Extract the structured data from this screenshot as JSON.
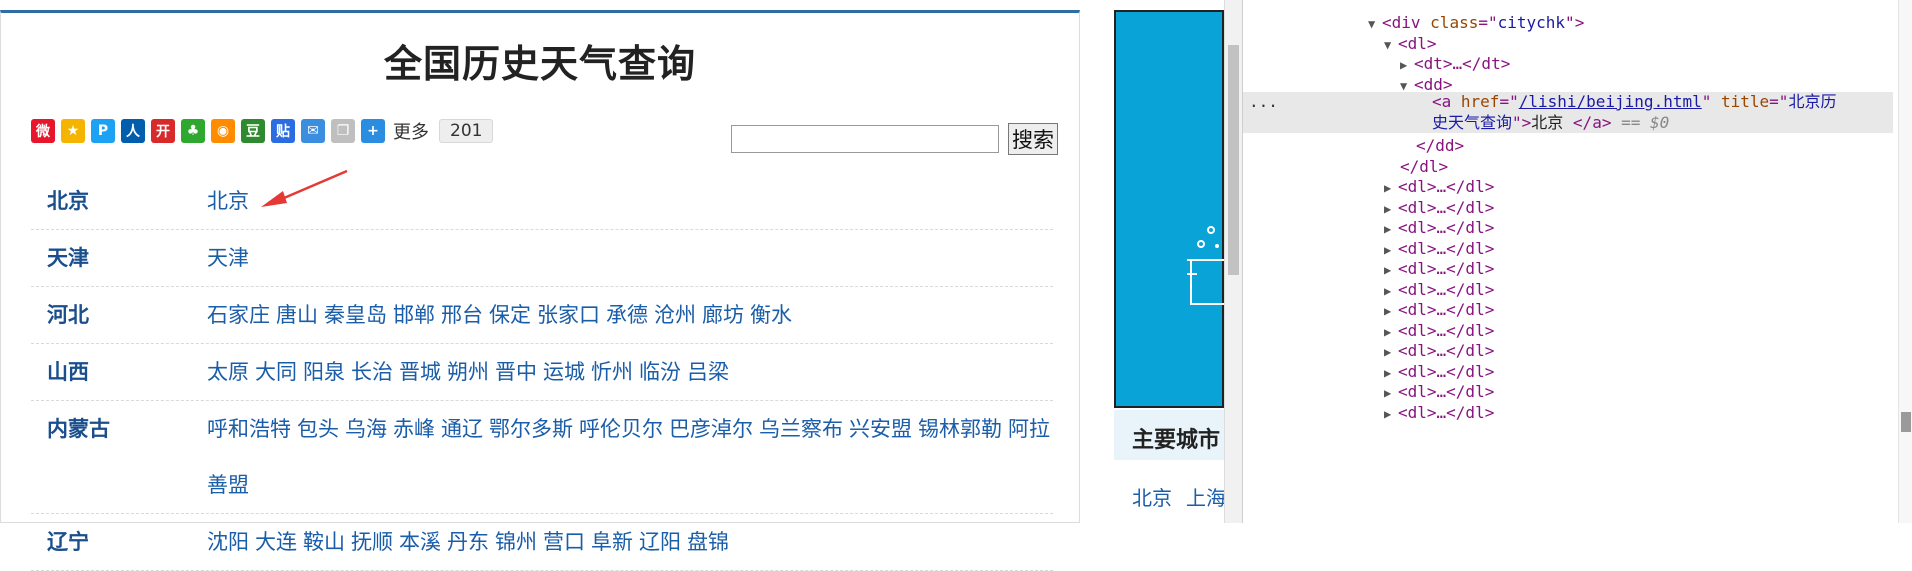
{
  "weather_page": {
    "title": "全国历史天气查询",
    "share": {
      "more_label": "更多",
      "count": "201",
      "icons": [
        {
          "name": "weibo-icon",
          "color": "#e6162d",
          "glyph": "微"
        },
        {
          "name": "qzone-icon",
          "color": "#f5b400",
          "glyph": "★"
        },
        {
          "name": "tencent-weibo-icon",
          "color": "#1da1f2",
          "glyph": "P"
        },
        {
          "name": "renren-icon",
          "color": "#005eac",
          "glyph": "人"
        },
        {
          "name": "kaixin-icon",
          "color": "#d82a2a",
          "glyph": "开"
        },
        {
          "name": "clover-icon",
          "color": "#2ea82e",
          "glyph": "♣"
        },
        {
          "name": "music-icon",
          "color": "#ff8c00",
          "glyph": "◉"
        },
        {
          "name": "douban-icon",
          "color": "#2f8a2f",
          "glyph": "豆"
        },
        {
          "name": "tieba-icon",
          "color": "#2b6de0",
          "glyph": "贴"
        },
        {
          "name": "mail-icon",
          "color": "#3b8ddf",
          "glyph": "✉"
        },
        {
          "name": "copy-icon",
          "color": "#bfbfbf",
          "glyph": "❐"
        },
        {
          "name": "plus-icon",
          "color": "#2b8de0",
          "glyph": "+"
        }
      ]
    },
    "search": {
      "placeholder": "",
      "button": "搜索"
    },
    "provinces": [
      {
        "name": "北京",
        "cities": [
          "北京"
        ]
      },
      {
        "name": "天津",
        "cities": [
          "天津"
        ]
      },
      {
        "name": "河北",
        "cities": [
          "石家庄",
          "唐山",
          "秦皇岛",
          "邯郸",
          "邢台",
          "保定",
          "张家口",
          "承德",
          "沧州",
          "廊坊",
          "衡水"
        ]
      },
      {
        "name": "山西",
        "cities": [
          "太原",
          "大同",
          "阳泉",
          "长治",
          "晋城",
          "朔州",
          "晋中",
          "运城",
          "忻州",
          "临汾",
          "吕梁"
        ]
      },
      {
        "name": "内蒙古",
        "cities": [
          "呼和浩特",
          "包头",
          "乌海",
          "赤峰",
          "通辽",
          "鄂尔多斯",
          "呼伦贝尔",
          "巴彦淖尔",
          "乌兰察布",
          "兴安盟",
          "锡林郭勒",
          "阿拉善盟"
        ]
      },
      {
        "name": "辽宁",
        "cities": [
          "沈阳",
          "大连",
          "鞍山",
          "抚顺",
          "本溪",
          "丹东",
          "锦州",
          "营口",
          "阜新",
          "辽阳",
          "盘锦"
        ]
      }
    ]
  },
  "sidebar": {
    "major_title": "主要城市",
    "major_cities": [
      "北京",
      "上海"
    ]
  },
  "devtools": {
    "lines": [
      {
        "indent": 0,
        "type": "open",
        "tri": "▼",
        "tag": "div",
        "attr": "class",
        "val": "citychk"
      },
      {
        "indent": 1,
        "type": "open",
        "tri": "▼",
        "tag": "dl"
      },
      {
        "indent": 2,
        "type": "collapsed",
        "tri": "▶",
        "tag": "dt"
      },
      {
        "indent": 2,
        "type": "open",
        "tri": "▼",
        "tag": "dd"
      },
      {
        "indent": 3,
        "type": "anchor",
        "href": "/lishi/beijing.html",
        "title_val_1": "北京历",
        "title_val_2": "史天气查询",
        "text": "北京 ",
        "eq": "== $0"
      },
      {
        "indent": 2,
        "type": "close",
        "tag": "dd"
      },
      {
        "indent": 1,
        "type": "close",
        "tag": "dl"
      },
      {
        "indent": 1,
        "type": "collapsed",
        "tri": "▶",
        "tag": "dl"
      },
      {
        "indent": 1,
        "type": "collapsed",
        "tri": "▶",
        "tag": "dl"
      },
      {
        "indent": 1,
        "type": "collapsed",
        "tri": "▶",
        "tag": "dl"
      },
      {
        "indent": 1,
        "type": "collapsed",
        "tri": "▶",
        "tag": "dl"
      },
      {
        "indent": 1,
        "type": "collapsed",
        "tri": "▶",
        "tag": "dl"
      },
      {
        "indent": 1,
        "type": "collapsed",
        "tri": "▶",
        "tag": "dl"
      },
      {
        "indent": 1,
        "type": "collapsed",
        "tri": "▶",
        "tag": "dl"
      },
      {
        "indent": 1,
        "type": "collapsed",
        "tri": "▶",
        "tag": "dl"
      },
      {
        "indent": 1,
        "type": "collapsed",
        "tri": "▶",
        "tag": "dl"
      },
      {
        "indent": 1,
        "type": "collapsed",
        "tri": "▶",
        "tag": "dl"
      },
      {
        "indent": 1,
        "type": "collapsed",
        "tri": "▶",
        "tag": "dl"
      },
      {
        "indent": 1,
        "type": "collapsed",
        "tri": "▶",
        "tag": "dl"
      }
    ],
    "dots": "..."
  }
}
